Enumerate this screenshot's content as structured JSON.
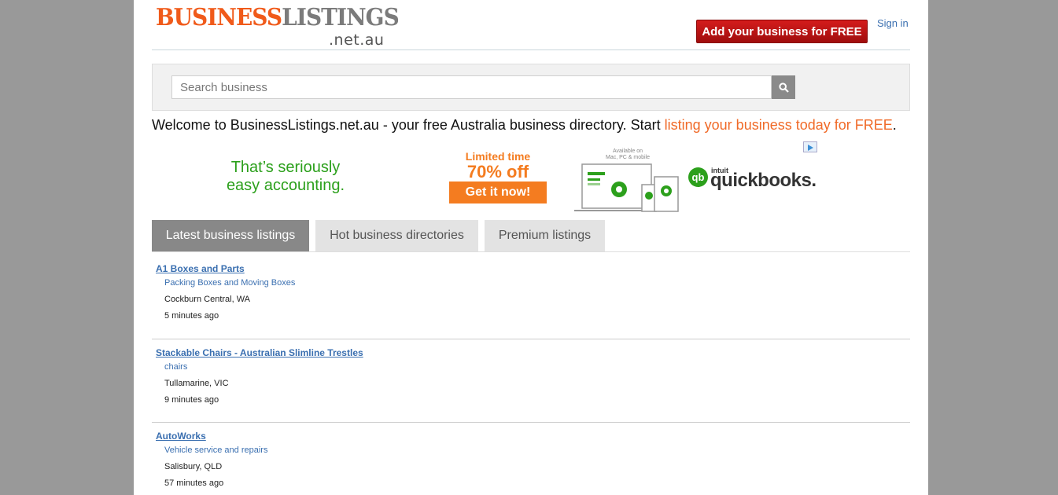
{
  "header": {
    "logo_part1": "BUSINESS",
    "logo_part2": "LISTINGS",
    "logo_sub": ".net.au",
    "add_button_label": "Add your business for FREE",
    "signin_label": "Sign in"
  },
  "search": {
    "placeholder": "Search business",
    "button_icon": "search-icon"
  },
  "welcome": {
    "text": "Welcome to BusinessListings.net.au - your free Australia business directory. Start ",
    "link": "listing your business today for FREE",
    "end": "."
  },
  "ad": {
    "line1": "That’s seriously",
    "line2": "easy accounting.",
    "limited": "Limited time",
    "offer": "70% off",
    "cta": "Get it now!",
    "available1": "Available on",
    "available2": "Mac, PC & mobile",
    "brand_small": "intuit",
    "brand": "quickbooks.",
    "brand_mark": "qb",
    "badge_icon": "adchoices-icon",
    "accent_color": "#2ca01c",
    "cta_color": "#f47c20"
  },
  "tabs": [
    {
      "label": "Latest business listings",
      "active": true
    },
    {
      "label": "Hot business directories",
      "active": false
    },
    {
      "label": "Premium listings",
      "active": false
    }
  ],
  "listings": [
    {
      "title": "A1 Boxes and Parts",
      "category": "Packing Boxes and Moving Boxes",
      "location": "Cockburn Central, WA",
      "time": "5 minutes ago"
    },
    {
      "title": "Stackable Chairs - Australian Slimline Trestles",
      "category": "chairs",
      "location": "Tullamarine, VIC",
      "time": "9 minutes ago"
    },
    {
      "title": "AutoWorks",
      "category": "Vehicle service and repairs",
      "location": "Salisbury, QLD",
      "time": "57 minutes ago"
    }
  ]
}
